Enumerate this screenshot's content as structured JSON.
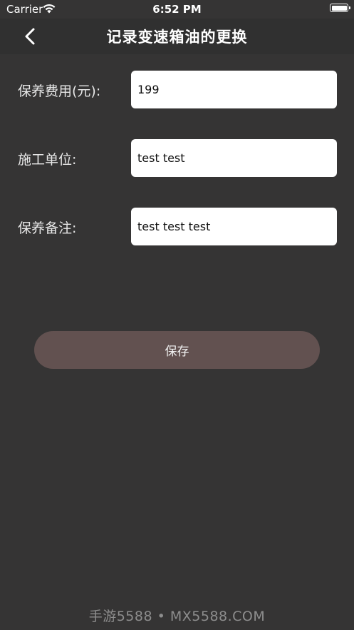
{
  "status_bar": {
    "carrier": "Carrier",
    "time": "6:52 PM",
    "battery_level": 1.0
  },
  "nav": {
    "title": "记录变速箱油的更换",
    "back_icon": "chevron-left-icon"
  },
  "form": {
    "fields": [
      {
        "label": "保养费用(元):",
        "value": "199"
      },
      {
        "label": "施工单位:",
        "value": "test test"
      },
      {
        "label": "保养备注:",
        "value": "test test test"
      }
    ]
  },
  "save_label": "保存",
  "watermark": "手游5588 • MX5588.COM",
  "colors": {
    "background": "#353434",
    "nav_background": "#303030",
    "button": "#625150",
    "input": "#ffffff"
  }
}
